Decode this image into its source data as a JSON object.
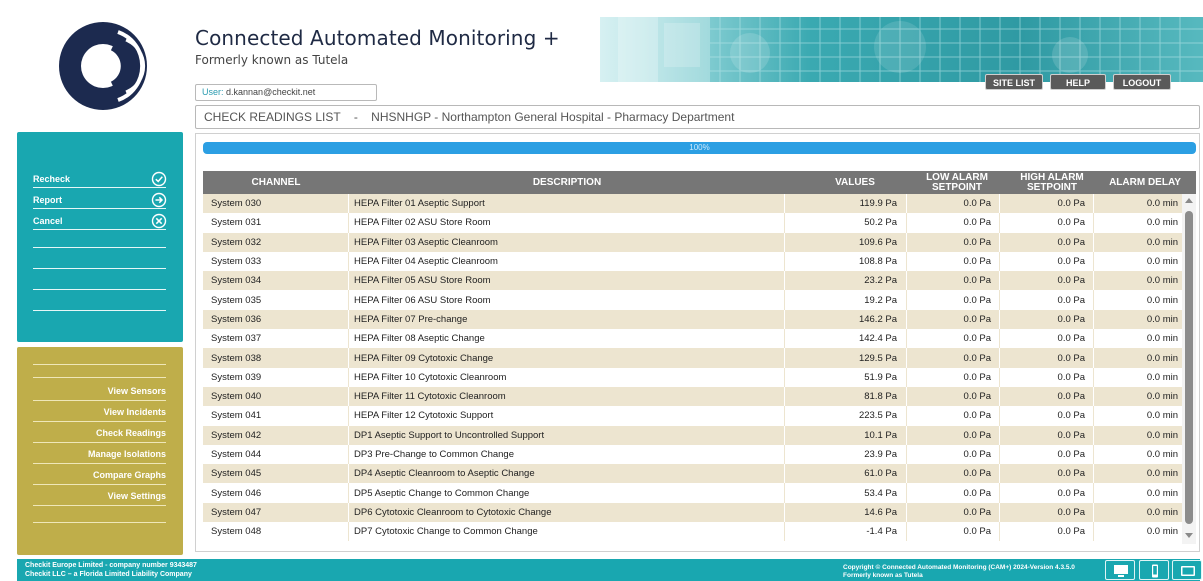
{
  "header": {
    "title": "Connected Automated Monitoring +",
    "subtitle": "Formerly known as Tutela",
    "user_label": "User:",
    "user_email": "d.kannan@checkit.net"
  },
  "topnav": {
    "site_list": "SITE LIST",
    "help": "HELP",
    "logout": "LOGOUT"
  },
  "breadcrumb": {
    "page": "CHECK READINGS LIST",
    "separator": "-",
    "site": "NHSNHGP - Northampton General Hospital - Pharmacy Department"
  },
  "actions": {
    "recheck": "Recheck",
    "report": "Report",
    "cancel": "Cancel"
  },
  "nav": {
    "view_sensors": "View Sensors",
    "view_incidents": "View Incidents",
    "check_readings": "Check Readings",
    "manage_isolations": "Manage Isolations",
    "compare_graphs": "Compare Graphs",
    "view_settings": "View Settings"
  },
  "progress": {
    "label": "100%",
    "value": 100
  },
  "table": {
    "headers": {
      "channel": "CHANNEL",
      "description": "DESCRIPTION",
      "values": "VALUES",
      "low_alarm_1": "LOW ALARM",
      "low_alarm_2": "SETPOINT",
      "high_alarm_1": "HIGH ALARM",
      "high_alarm_2": "SETPOINT",
      "alarm_delay": "ALARM DELAY"
    },
    "rows": [
      {
        "channel": "System 030",
        "description": "HEPA Filter 01 Aseptic Support",
        "value": "119.9 Pa",
        "low": "0.0 Pa",
        "high": "0.0 Pa",
        "delay": "0.0 min"
      },
      {
        "channel": "System 031",
        "description": "HEPA Filter 02 ASU Store Room",
        "value": "50.2 Pa",
        "low": "0.0 Pa",
        "high": "0.0 Pa",
        "delay": "0.0 min"
      },
      {
        "channel": "System 032",
        "description": "HEPA Filter 03 Aseptic Cleanroom",
        "value": "109.6 Pa",
        "low": "0.0 Pa",
        "high": "0.0 Pa",
        "delay": "0.0 min"
      },
      {
        "channel": "System 033",
        "description": "HEPA Filter 04 Aseptic Cleanroom",
        "value": "108.8 Pa",
        "low": "0.0 Pa",
        "high": "0.0 Pa",
        "delay": "0.0 min"
      },
      {
        "channel": "System 034",
        "description": "HEPA Filter 05 ASU Store Room",
        "value": "23.2 Pa",
        "low": "0.0 Pa",
        "high": "0.0 Pa",
        "delay": "0.0 min"
      },
      {
        "channel": "System 035",
        "description": "HEPA Filter 06 ASU Store Room",
        "value": "19.2 Pa",
        "low": "0.0 Pa",
        "high": "0.0 Pa",
        "delay": "0.0 min"
      },
      {
        "channel": "System 036",
        "description": "HEPA Filter 07 Pre-change",
        "value": "146.2 Pa",
        "low": "0.0 Pa",
        "high": "0.0 Pa",
        "delay": "0.0 min"
      },
      {
        "channel": "System 037",
        "description": "HEPA Filter 08 Aseptic Change",
        "value": "142.4 Pa",
        "low": "0.0 Pa",
        "high": "0.0 Pa",
        "delay": "0.0 min"
      },
      {
        "channel": "System 038",
        "description": "HEPA Filter 09 Cytotoxic Change",
        "value": "129.5 Pa",
        "low": "0.0 Pa",
        "high": "0.0 Pa",
        "delay": "0.0 min"
      },
      {
        "channel": "System 039",
        "description": "HEPA Filter 10 Cytotoxic Cleanroom",
        "value": "51.9 Pa",
        "low": "0.0 Pa",
        "high": "0.0 Pa",
        "delay": "0.0 min"
      },
      {
        "channel": "System 040",
        "description": "HEPA Filter 11 Cytotoxic Cleanroom",
        "value": "81.8 Pa",
        "low": "0.0 Pa",
        "high": "0.0 Pa",
        "delay": "0.0 min"
      },
      {
        "channel": "System 041",
        "description": "HEPA Filter 12 Cytotoxic Support",
        "value": "223.5 Pa",
        "low": "0.0 Pa",
        "high": "0.0 Pa",
        "delay": "0.0 min"
      },
      {
        "channel": "System 042",
        "description": "DP1 Aseptic Support to Uncontrolled Support",
        "value": "10.1 Pa",
        "low": "0.0 Pa",
        "high": "0.0 Pa",
        "delay": "0.0 min"
      },
      {
        "channel": "System 044",
        "description": "DP3 Pre-Change to Common Change",
        "value": "23.9 Pa",
        "low": "0.0 Pa",
        "high": "0.0 Pa",
        "delay": "0.0 min"
      },
      {
        "channel": "System 045",
        "description": "DP4 Aseptic Cleanroom to Aseptic Change",
        "value": "61.0 Pa",
        "low": "0.0 Pa",
        "high": "0.0 Pa",
        "delay": "0.0 min"
      },
      {
        "channel": "System 046",
        "description": "DP5 Aseptic Change to Common Change",
        "value": "53.4 Pa",
        "low": "0.0 Pa",
        "high": "0.0 Pa",
        "delay": "0.0 min"
      },
      {
        "channel": "System 047",
        "description": "DP6 Cytotoxic Cleanroom to Cytotoxic Change",
        "value": "14.6 Pa",
        "low": "0.0 Pa",
        "high": "0.0 Pa",
        "delay": "0.0 min"
      },
      {
        "channel": "System 048",
        "description": "DP7 Cytotoxic Change to Common Change",
        "value": "-1.4 Pa",
        "low": "0.0 Pa",
        "high": "0.0 Pa",
        "delay": "0.0 min"
      }
    ]
  },
  "footer": {
    "company_line1": "Checkit Europe Limited - company number 9343487",
    "company_line2": "Checkit LLC – a Florida Limited Liability Company",
    "copyright": "Copyright © Connected Automated Monitoring (CAM+) 2024-Version 4.3.5.0",
    "copyright_sub": "Formerly known as Tutela"
  },
  "icons": {
    "recheck": "check-circle-icon",
    "report": "arrow-circle-icon",
    "cancel": "x-circle-icon",
    "footer_1": "monitor-icon",
    "footer_2": "mobile-icon",
    "footer_3": "tablet-icon"
  },
  "colors": {
    "teal": "#19a7b0",
    "olive": "#bfae4a",
    "progress": "#2c9fe3",
    "table_header": "#767676",
    "row_alt": "#ede5d0"
  }
}
